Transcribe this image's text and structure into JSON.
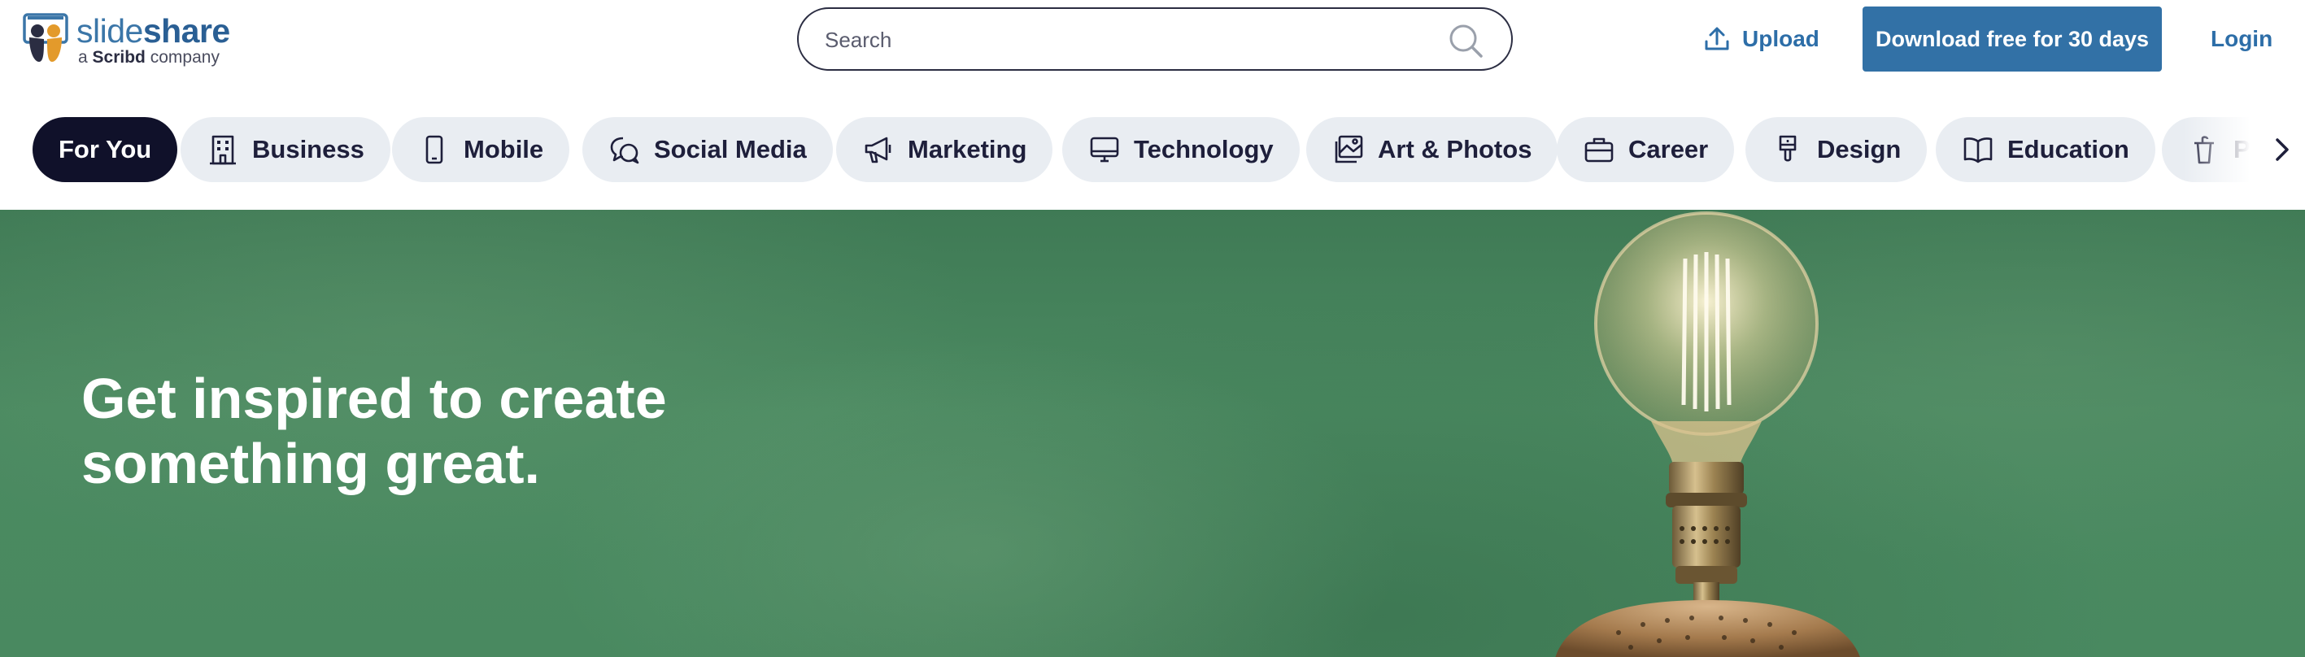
{
  "brand": {
    "name_part1": "slide",
    "name_part2": "share",
    "tagline_prefix": "a",
    "tagline_brand": "Scribd",
    "tagline_suffix": "company",
    "colors": {
      "primary": "#3271a6",
      "link": "#2d6ea8",
      "dark": "#10112a",
      "pill": "#e9edf2",
      "hero_green": "#4b8a61"
    }
  },
  "header": {
    "search_placeholder": "Search",
    "upload_label": "Upload",
    "download_label": "Download free for 30 days",
    "login_label": "Login"
  },
  "categories": [
    {
      "label": "For You",
      "icon": "none",
      "active": true
    },
    {
      "label": "Business",
      "icon": "building-icon",
      "active": false
    },
    {
      "label": "Mobile",
      "icon": "phone-icon",
      "active": false
    },
    {
      "label": "Social Media",
      "icon": "chat-bubbles-icon",
      "active": false
    },
    {
      "label": "Marketing",
      "icon": "megaphone-icon",
      "active": false
    },
    {
      "label": "Technology",
      "icon": "monitor-icon",
      "active": false
    },
    {
      "label": "Art & Photos",
      "icon": "pictures-icon",
      "active": false
    },
    {
      "label": "Career",
      "icon": "briefcase-icon",
      "active": false
    },
    {
      "label": "Design",
      "icon": "paintbrush-icon",
      "active": false
    },
    {
      "label": "Education",
      "icon": "open-book-icon",
      "active": false
    },
    {
      "label": "Pr",
      "icon": "podium-icon",
      "active": false
    }
  ],
  "hero": {
    "line1": "Get inspired to create",
    "line2": "something great."
  }
}
